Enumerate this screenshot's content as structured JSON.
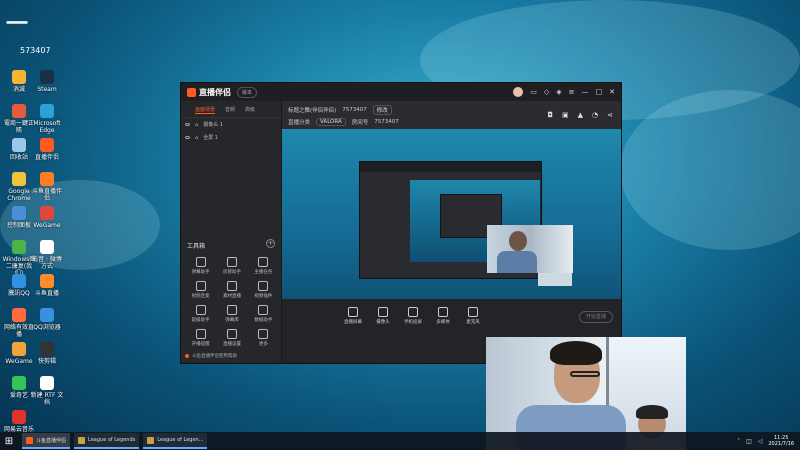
{
  "watermark": {
    "logo_text": "一",
    "id": "573407"
  },
  "desktop": {
    "icons": [
      {
        "label": "消滅",
        "color": "#f6b334"
      },
      {
        "label": "電商一鍵正賬",
        "color": "#e35d3c"
      },
      {
        "label": "回收站",
        "color": "#9cc7e8"
      },
      {
        "label": "Google Chrome",
        "color": "#f2c23b"
      },
      {
        "label": "控制面板",
        "color": "#4a8fd9"
      },
      {
        "label": "Windows图二康复(我们)",
        "color": "#4bb34a"
      },
      {
        "label": "騰訊QQ",
        "color": "#2f93e0"
      },
      {
        "label": "网络有效直播",
        "color": "#ff6b3a"
      },
      {
        "label": "WeGame",
        "color": "#f3a33c"
      },
      {
        "label": "爱奇艺",
        "color": "#33c45a"
      },
      {
        "label": "网易云音乐",
        "color": "#e1322d"
      },
      {
        "label": "Steam",
        "color": "#1c2f48"
      },
      {
        "label": "Microsoft Edge",
        "color": "#2fa0d8"
      },
      {
        "label": "直播伴侣",
        "color": "#ff5a1f"
      },
      {
        "label": "斗鱼直播伴侣",
        "color": "#ff7d22"
      },
      {
        "label": "WeGame",
        "color": "#e0463a"
      },
      {
        "label": "影音 · 微博方式",
        "color": "#ffffff"
      },
      {
        "label": "斗鱼直播",
        "color": "#ff8b2a"
      },
      {
        "label": "QQ浏览器",
        "color": "#3a8fe0"
      },
      {
        "label": "快剪辑",
        "color": "#333333"
      },
      {
        "label": "新建 RTF 文档",
        "color": "#ffffff"
      }
    ]
  },
  "app": {
    "name": "直播伴侣",
    "version": "版本",
    "left_tabs": [
      "画面场景",
      "音频",
      "高级"
    ],
    "sources": [
      "摄像头 1",
      "全屏 1"
    ],
    "tools_title": "工具箱",
    "tools": [
      "弹幕助手",
      "房管助手",
      "主播任务",
      "视频连麦",
      "素材直播",
      "视频插件",
      "超级助手",
      "弹幕库",
      "数据助手",
      "开播提醒",
      "直播设置",
      "更多"
    ],
    "footer_text": "斗鱼直播伴侣使用帮助",
    "room_title": "标题之舞(伴侣伴侣)",
    "room_id": "7573407",
    "modify": "修改",
    "channel_label": "直播分类",
    "channel_value": "VALORA",
    "room_label": "房间号",
    "room_value": "7573407",
    "scene_buttons": [
      "直播屏幕",
      "摄像头",
      "手机投屏",
      "多媒体",
      "麦克风"
    ],
    "start_live": "开始直播"
  },
  "taskbar": {
    "items": [
      {
        "label": "斗鱼直播伴侣",
        "color": "#ff5a1f"
      },
      {
        "label": "League of Legends",
        "color": "#c8a24a"
      },
      {
        "label": "League of Legen...",
        "color": "#c8a24a"
      }
    ],
    "time": "11:25",
    "date": "2021/7/16"
  }
}
